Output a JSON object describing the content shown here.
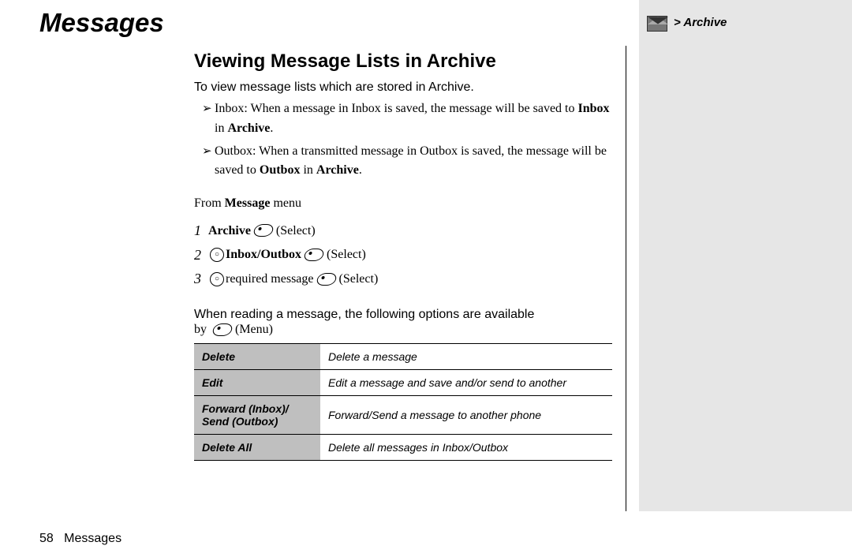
{
  "header": "Messages",
  "side": {
    "breadcrumb": "> Archive",
    "icon": "envelope-icon"
  },
  "section_title": "Viewing Message Lists in Archive",
  "intro": "To view message lists which are stored in Archive.",
  "bullets": [
    {
      "pre": "Inbox: When a message in Inbox is saved, the message will be saved to ",
      "bold1": "Inbox",
      "mid": " in ",
      "bold2": "Archive",
      "post": "."
    },
    {
      "pre": "Outbox: When a transmitted message in Outbox is saved, the message will be saved to ",
      "bold1": "Outbox",
      "mid": " in ",
      "bold2": "Archive",
      "post": "."
    }
  ],
  "from_line": {
    "pre": "From ",
    "bold": "Message",
    "post": " menu"
  },
  "steps": [
    {
      "num": "1",
      "bold": "Archive",
      "tail": "(Select)"
    },
    {
      "num": "2",
      "nav": true,
      "bold": "Inbox/Outbox",
      "tail": "(Select)"
    },
    {
      "num": "3",
      "nav": true,
      "plain": "required message",
      "tail": "(Select)"
    }
  ],
  "options_intro": {
    "line1": "When reading a message, the following options are available",
    "line2_pre": "by ",
    "line2_tail": "(Menu)"
  },
  "options_table": [
    {
      "label": "Delete",
      "desc": "Delete a message"
    },
    {
      "label": "Edit",
      "desc": "Edit a message and save and/or send to another"
    },
    {
      "label": "Forward (Inbox)/\nSend (Outbox)",
      "desc": "Forward/Send a message to another phone"
    },
    {
      "label": "Delete All",
      "desc": "Delete all messages in Inbox/Outbox"
    }
  ],
  "footer": {
    "page": "58",
    "section": "Messages"
  }
}
